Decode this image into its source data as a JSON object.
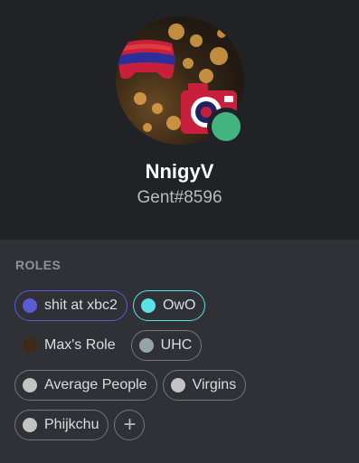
{
  "profile": {
    "username": "NnigyV",
    "tag": "Gent#8596",
    "status_color": "#43b581",
    "avatar_icons": [
      "gamepad-icon",
      "camera-icon"
    ]
  },
  "roles_section": {
    "heading": "ROLES",
    "add_icon": "plus-icon",
    "add_label": "+",
    "items": [
      {
        "label": "shit at xbc2",
        "color": "#5b5bd6"
      },
      {
        "label": "OwO",
        "color": "#5ce1e6"
      },
      {
        "label": "Max's Role",
        "color": "#3e2a14"
      },
      {
        "label": "UHC",
        "color": "#95a5a6"
      },
      {
        "label": "Average People",
        "color": "#c4c4c4"
      },
      {
        "label": "Virgins",
        "color": "#c4c4c4"
      },
      {
        "label": "Phijkchu",
        "color": "#c4c4c4"
      }
    ]
  }
}
